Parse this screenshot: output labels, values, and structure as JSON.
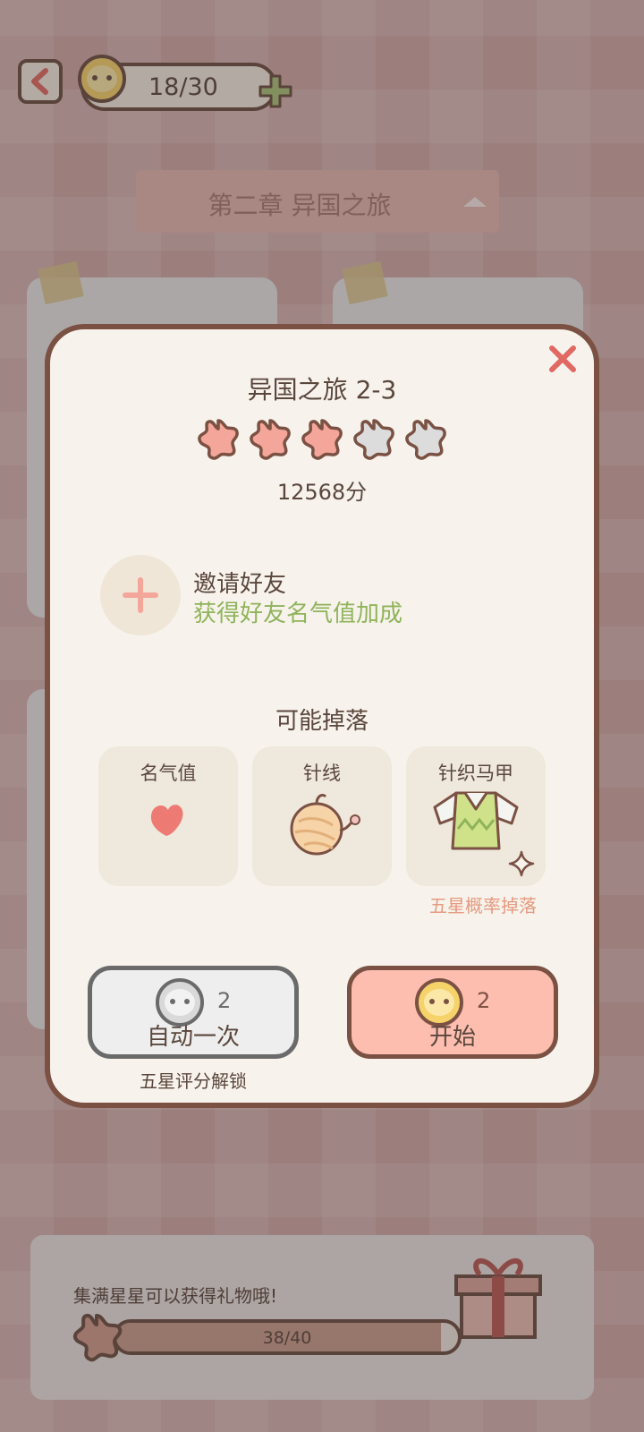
{
  "header": {
    "back_icon": "chevron-left-icon",
    "coin_display": "18/30",
    "add_icon": "plus-icon"
  },
  "chapter": {
    "title": "第二章  异国之旅",
    "dropdown_icon": "caret-up-icon"
  },
  "modal": {
    "title": "异国之旅 2-3",
    "stars_total": 5,
    "stars_earned": 3,
    "score": "12568分",
    "invite": {
      "title": "邀请好友",
      "subtitle": "获得好友名气值加成"
    },
    "drops": {
      "heading": "可能掉落",
      "items": [
        {
          "name": "名气值",
          "icon": "heart-icon"
        },
        {
          "name": "针线",
          "icon": "yarn-ball-icon"
        },
        {
          "name": "针织马甲",
          "icon": "knit-vest-icon"
        }
      ],
      "note": "五星概率掉落"
    },
    "auto_button": {
      "label": "自动一次",
      "cost": "2",
      "note": "五星评分解锁"
    },
    "start_button": {
      "label": "开始",
      "cost": "2"
    }
  },
  "progress": {
    "message": "集满星星可以获得礼物哦!",
    "value_text": "38/40",
    "fraction": 0.95
  },
  "colors": {
    "accent": "#fdbeb0",
    "star_on": "#f4a69a",
    "star_off": "#dcdcdc",
    "invite_green": "#8fb35a",
    "note_orange": "#e59a7f"
  }
}
